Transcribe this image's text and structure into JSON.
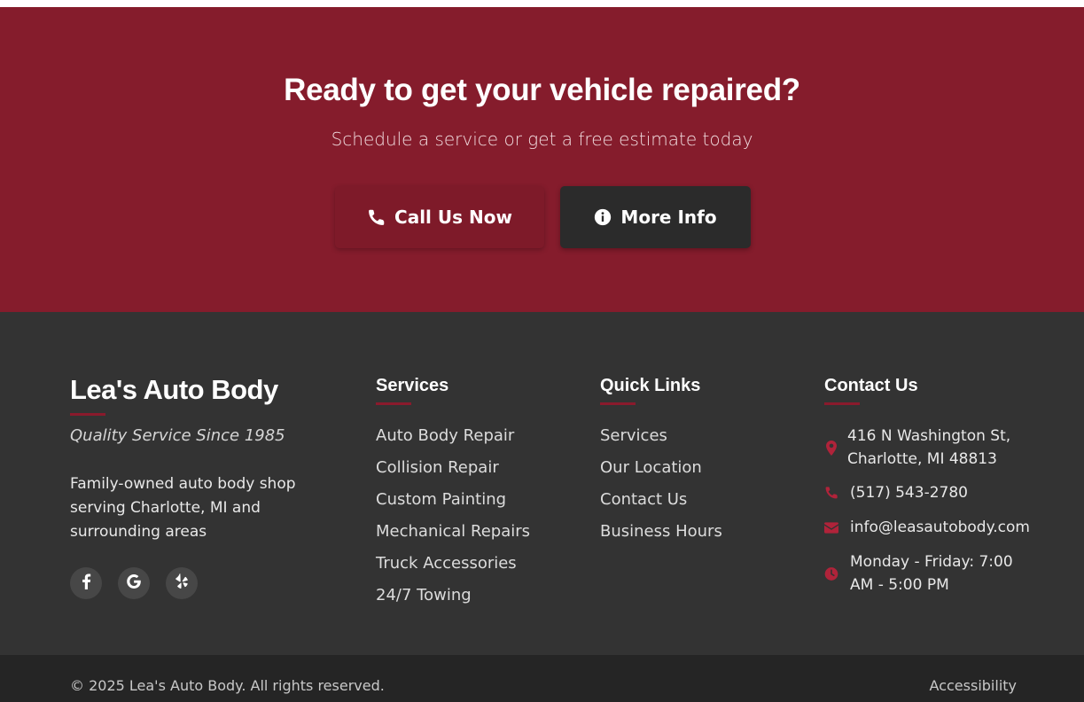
{
  "cta": {
    "title": "Ready to get your vehicle repaired?",
    "subtitle": "Schedule a service or get a free estimate today",
    "call_button": {
      "label": "Call Us Now",
      "icon": "phone-icon"
    },
    "more_button": {
      "label": "More Info",
      "icon": "info-circle-icon"
    }
  },
  "footer": {
    "brand": {
      "name": "Lea's Auto Body",
      "tagline": "Quality Service Since 1985",
      "description": "Family-owned auto body shop serving Charlotte, MI and surrounding areas",
      "social": [
        "facebook-icon",
        "google-icon",
        "yelp-icon"
      ]
    },
    "services": {
      "title": "Services",
      "items": [
        "Auto Body Repair",
        "Collision Repair",
        "Custom Painting",
        "Mechanical Repairs",
        "Truck Accessories",
        "24/7 Towing"
      ]
    },
    "quick_links": {
      "title": "Quick Links",
      "items": [
        "Services",
        "Our Location",
        "Contact Us",
        "Business Hours"
      ]
    },
    "contact": {
      "title": "Contact Us",
      "address": "416 N Washington St, Charlotte, MI 48813",
      "phone": "(517) 543-2780",
      "email": "info@leasautobody.com",
      "hours": "Monday - Friday: 7:00 AM - 5:00 PM"
    }
  },
  "bottom": {
    "copyright": "© 2025 Lea's Auto Body. All rights reserved.",
    "accessibility": "Accessibility"
  },
  "colors": {
    "brand_red": "#851c2c",
    "footer_bg": "#333333",
    "bottom_bg": "#252525",
    "dark_button": "#2b2b2b",
    "accent_icon": "#b0233a"
  }
}
